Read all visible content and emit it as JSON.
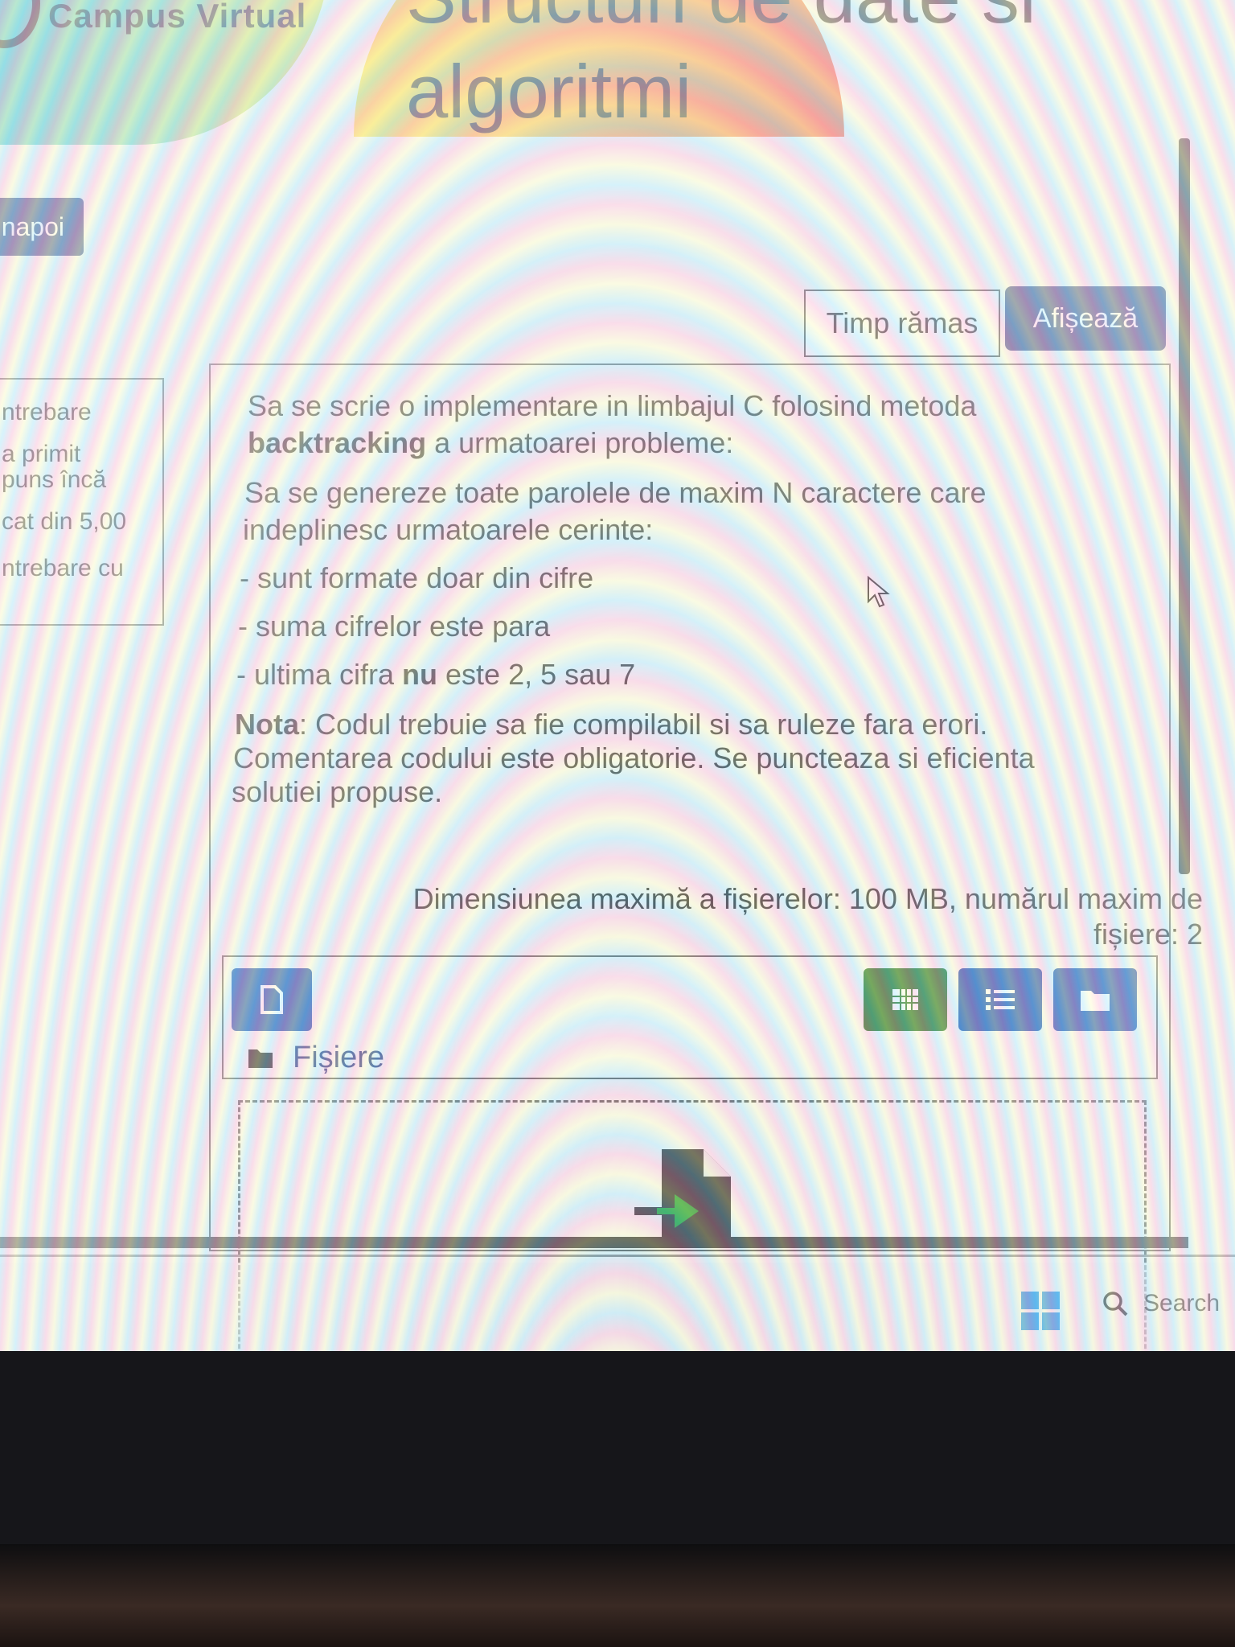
{
  "header": {
    "logo_text": "Campus Virtual",
    "course_title_line1": "Structuri de date si",
    "course_title_line2": "algoritmi"
  },
  "nav": {
    "back_label": "napoi"
  },
  "timer": {
    "label": "Timp rămas",
    "show_button": "Afișează"
  },
  "info_panel": {
    "lines": [
      "ntrebare",
      "a primit",
      "puns încă",
      "cat din 5,00",
      "ntrebare cu"
    ]
  },
  "question": {
    "line1": "Sa se scrie o implementare in limbajul C folosind metoda",
    "line2_bold": "backtracking",
    "line2_rest": " a urmatoarei probleme:",
    "line3": "Sa se genereze toate parolele de maxim N caractere care",
    "line4": "indeplinesc urmatoarele cerinte:",
    "req1": "- sunt formate doar din cifre",
    "req2": "- suma cifrelor este para",
    "req3_pre": "- ultima cifra ",
    "req3_bold": "nu",
    "req3_post": " este 2, 5 sau 7",
    "note_bold": "Nota",
    "note_line1": ": Codul trebuie sa fie compilabil si sa ruleze fara erori.",
    "note_line2": "Comentarea codului este obligatorie. Se puncteaza si eficienta",
    "note_line3": "solutiei propuse."
  },
  "upload": {
    "limit_line1": "Dimensiunea maximă a fișierelor: 100 MB, numărul maxim de",
    "limit_line2": "fișiere: 2",
    "files_label": "Fișiere",
    "icons": {
      "add_file": "file-icon",
      "grid_view": "grid-icon",
      "list_view": "list-icon",
      "tree_view": "folder-icon",
      "drop": "file-import-icon"
    }
  },
  "taskbar": {
    "search_label": "Search"
  },
  "colors": {
    "primary": "#1a2f72",
    "green_button": "#1b6e1b",
    "blue_button": "#0f47a8",
    "windows_blue": "#1a8fe0"
  }
}
